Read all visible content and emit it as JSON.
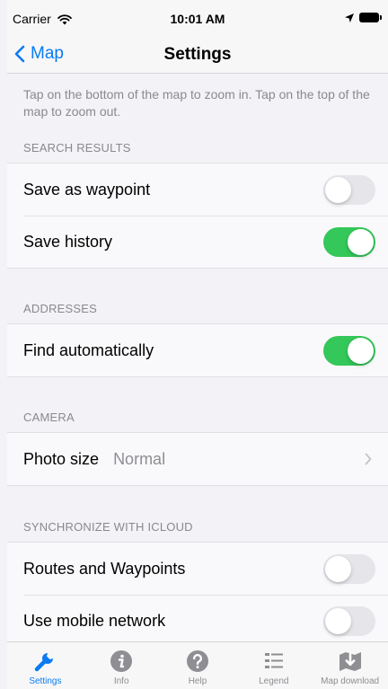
{
  "status_bar": {
    "carrier": "Carrier",
    "time": "10:01 AM"
  },
  "nav": {
    "back_label": "Map",
    "title": "Settings"
  },
  "note": "Tap on the bottom of the map to zoom in. Tap on the top of the map to zoom out.",
  "sections": {
    "search_results": {
      "header": "SEARCH RESULTS",
      "rows": [
        {
          "label": "Save as waypoint",
          "toggle_on": false
        },
        {
          "label": "Save history",
          "toggle_on": true
        }
      ]
    },
    "addresses": {
      "header": "ADDRESSES",
      "rows": [
        {
          "label": "Find automatically",
          "toggle_on": true
        }
      ]
    },
    "camera": {
      "header": "CAMERA",
      "rows": [
        {
          "label": "Photo size",
          "value": "Normal"
        }
      ]
    },
    "icloud": {
      "header": "SYNCHRONIZE WITH ICLOUD",
      "rows": [
        {
          "label": "Routes and Waypoints",
          "toggle_on": false
        },
        {
          "label": "Use mobile network",
          "toggle_on": false
        }
      ]
    }
  },
  "tab_bar": {
    "tabs": [
      {
        "label": "Settings",
        "icon": "wrench-icon",
        "active": true
      },
      {
        "label": "Info",
        "icon": "info-icon",
        "active": false
      },
      {
        "label": "Help",
        "icon": "help-icon",
        "active": false
      },
      {
        "label": "Legend",
        "icon": "legend-list-icon",
        "active": false
      },
      {
        "label": "Map download",
        "icon": "map-download-icon",
        "active": false
      }
    ]
  },
  "colors": {
    "accent": "#0a7bf2",
    "toggle_on": "#34c759",
    "toggle_off": "#e5e5ea",
    "secondary_text": "#8a8a8e"
  }
}
